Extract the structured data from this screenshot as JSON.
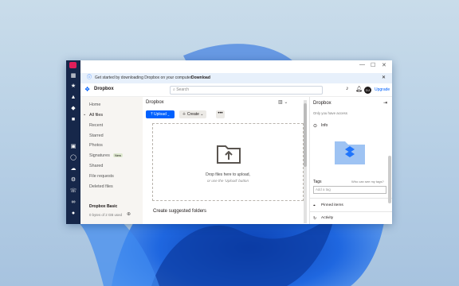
{
  "banner": {
    "text": "Get started by downloading Dropbox on your computer.",
    "link": "Download"
  },
  "brand": {
    "name": "Dropbox"
  },
  "search": {
    "placeholder": "Search"
  },
  "header_actions": {
    "upgrade": "Upgrade",
    "avatar_initials": "DJ"
  },
  "sidebar": {
    "items": [
      "Home",
      "All files",
      "Recent",
      "Starred",
      "Photos",
      "Signatures",
      "Shared",
      "File requests",
      "Deleted files"
    ],
    "signatures_badge": "New",
    "plan": "Dropbox Basic",
    "storage": "0 bytes of 2 GB used"
  },
  "main": {
    "breadcrumb": "Dropbox",
    "upload_label": "Upload",
    "create_label": "Create",
    "more_label": "•••",
    "drop_line1": "Drop files here to upload,",
    "drop_line2": "or use the 'Upload' button",
    "suggested": "Create suggested folders"
  },
  "details": {
    "title": "Dropbox",
    "access": "Only you have access",
    "info": "Info",
    "tags_label": "Tags",
    "tags_help": "Who can see my tags?",
    "tag_placeholder": "Add a tag",
    "pinned": "Pinned items",
    "activity": "Activity"
  },
  "colors": {
    "accent": "#0061fe",
    "rail": "#16274a",
    "banner": "#e7f0fb",
    "sidebar": "#f7f5f2"
  }
}
